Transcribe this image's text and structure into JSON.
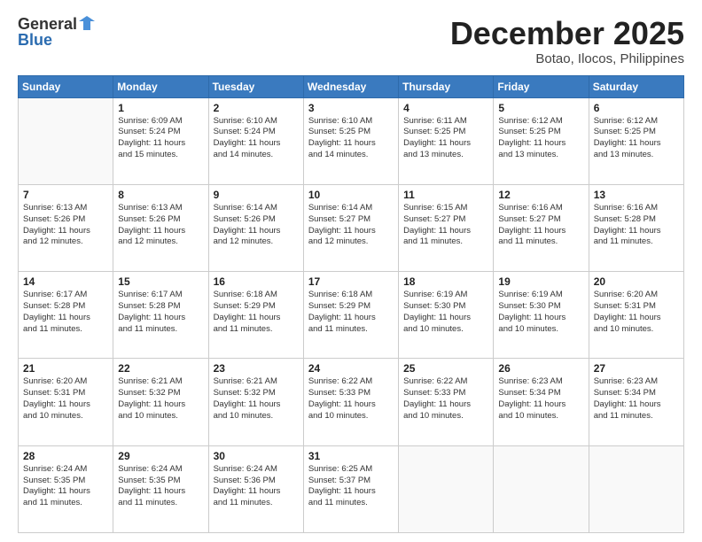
{
  "header": {
    "logo_general": "General",
    "logo_blue": "Blue",
    "month_title": "December 2025",
    "location": "Botao, Ilocos, Philippines"
  },
  "days_of_week": [
    "Sunday",
    "Monday",
    "Tuesday",
    "Wednesday",
    "Thursday",
    "Friday",
    "Saturday"
  ],
  "weeks": [
    [
      {
        "day": "",
        "info": ""
      },
      {
        "day": "1",
        "info": "Sunrise: 6:09 AM\nSunset: 5:24 PM\nDaylight: 11 hours\nand 15 minutes."
      },
      {
        "day": "2",
        "info": "Sunrise: 6:10 AM\nSunset: 5:24 PM\nDaylight: 11 hours\nand 14 minutes."
      },
      {
        "day": "3",
        "info": "Sunrise: 6:10 AM\nSunset: 5:25 PM\nDaylight: 11 hours\nand 14 minutes."
      },
      {
        "day": "4",
        "info": "Sunrise: 6:11 AM\nSunset: 5:25 PM\nDaylight: 11 hours\nand 13 minutes."
      },
      {
        "day": "5",
        "info": "Sunrise: 6:12 AM\nSunset: 5:25 PM\nDaylight: 11 hours\nand 13 minutes."
      },
      {
        "day": "6",
        "info": "Sunrise: 6:12 AM\nSunset: 5:25 PM\nDaylight: 11 hours\nand 13 minutes."
      }
    ],
    [
      {
        "day": "7",
        "info": "Sunrise: 6:13 AM\nSunset: 5:26 PM\nDaylight: 11 hours\nand 12 minutes."
      },
      {
        "day": "8",
        "info": "Sunrise: 6:13 AM\nSunset: 5:26 PM\nDaylight: 11 hours\nand 12 minutes."
      },
      {
        "day": "9",
        "info": "Sunrise: 6:14 AM\nSunset: 5:26 PM\nDaylight: 11 hours\nand 12 minutes."
      },
      {
        "day": "10",
        "info": "Sunrise: 6:14 AM\nSunset: 5:27 PM\nDaylight: 11 hours\nand 12 minutes."
      },
      {
        "day": "11",
        "info": "Sunrise: 6:15 AM\nSunset: 5:27 PM\nDaylight: 11 hours\nand 11 minutes."
      },
      {
        "day": "12",
        "info": "Sunrise: 6:16 AM\nSunset: 5:27 PM\nDaylight: 11 hours\nand 11 minutes."
      },
      {
        "day": "13",
        "info": "Sunrise: 6:16 AM\nSunset: 5:28 PM\nDaylight: 11 hours\nand 11 minutes."
      }
    ],
    [
      {
        "day": "14",
        "info": "Sunrise: 6:17 AM\nSunset: 5:28 PM\nDaylight: 11 hours\nand 11 minutes."
      },
      {
        "day": "15",
        "info": "Sunrise: 6:17 AM\nSunset: 5:28 PM\nDaylight: 11 hours\nand 11 minutes."
      },
      {
        "day": "16",
        "info": "Sunrise: 6:18 AM\nSunset: 5:29 PM\nDaylight: 11 hours\nand 11 minutes."
      },
      {
        "day": "17",
        "info": "Sunrise: 6:18 AM\nSunset: 5:29 PM\nDaylight: 11 hours\nand 11 minutes."
      },
      {
        "day": "18",
        "info": "Sunrise: 6:19 AM\nSunset: 5:30 PM\nDaylight: 11 hours\nand 10 minutes."
      },
      {
        "day": "19",
        "info": "Sunrise: 6:19 AM\nSunset: 5:30 PM\nDaylight: 11 hours\nand 10 minutes."
      },
      {
        "day": "20",
        "info": "Sunrise: 6:20 AM\nSunset: 5:31 PM\nDaylight: 11 hours\nand 10 minutes."
      }
    ],
    [
      {
        "day": "21",
        "info": "Sunrise: 6:20 AM\nSunset: 5:31 PM\nDaylight: 11 hours\nand 10 minutes."
      },
      {
        "day": "22",
        "info": "Sunrise: 6:21 AM\nSunset: 5:32 PM\nDaylight: 11 hours\nand 10 minutes."
      },
      {
        "day": "23",
        "info": "Sunrise: 6:21 AM\nSunset: 5:32 PM\nDaylight: 11 hours\nand 10 minutes."
      },
      {
        "day": "24",
        "info": "Sunrise: 6:22 AM\nSunset: 5:33 PM\nDaylight: 11 hours\nand 10 minutes."
      },
      {
        "day": "25",
        "info": "Sunrise: 6:22 AM\nSunset: 5:33 PM\nDaylight: 11 hours\nand 10 minutes."
      },
      {
        "day": "26",
        "info": "Sunrise: 6:23 AM\nSunset: 5:34 PM\nDaylight: 11 hours\nand 10 minutes."
      },
      {
        "day": "27",
        "info": "Sunrise: 6:23 AM\nSunset: 5:34 PM\nDaylight: 11 hours\nand 11 minutes."
      }
    ],
    [
      {
        "day": "28",
        "info": "Sunrise: 6:24 AM\nSunset: 5:35 PM\nDaylight: 11 hours\nand 11 minutes."
      },
      {
        "day": "29",
        "info": "Sunrise: 6:24 AM\nSunset: 5:35 PM\nDaylight: 11 hours\nand 11 minutes."
      },
      {
        "day": "30",
        "info": "Sunrise: 6:24 AM\nSunset: 5:36 PM\nDaylight: 11 hours\nand 11 minutes."
      },
      {
        "day": "31",
        "info": "Sunrise: 6:25 AM\nSunset: 5:37 PM\nDaylight: 11 hours\nand 11 minutes."
      },
      {
        "day": "",
        "info": ""
      },
      {
        "day": "",
        "info": ""
      },
      {
        "day": "",
        "info": ""
      }
    ]
  ]
}
